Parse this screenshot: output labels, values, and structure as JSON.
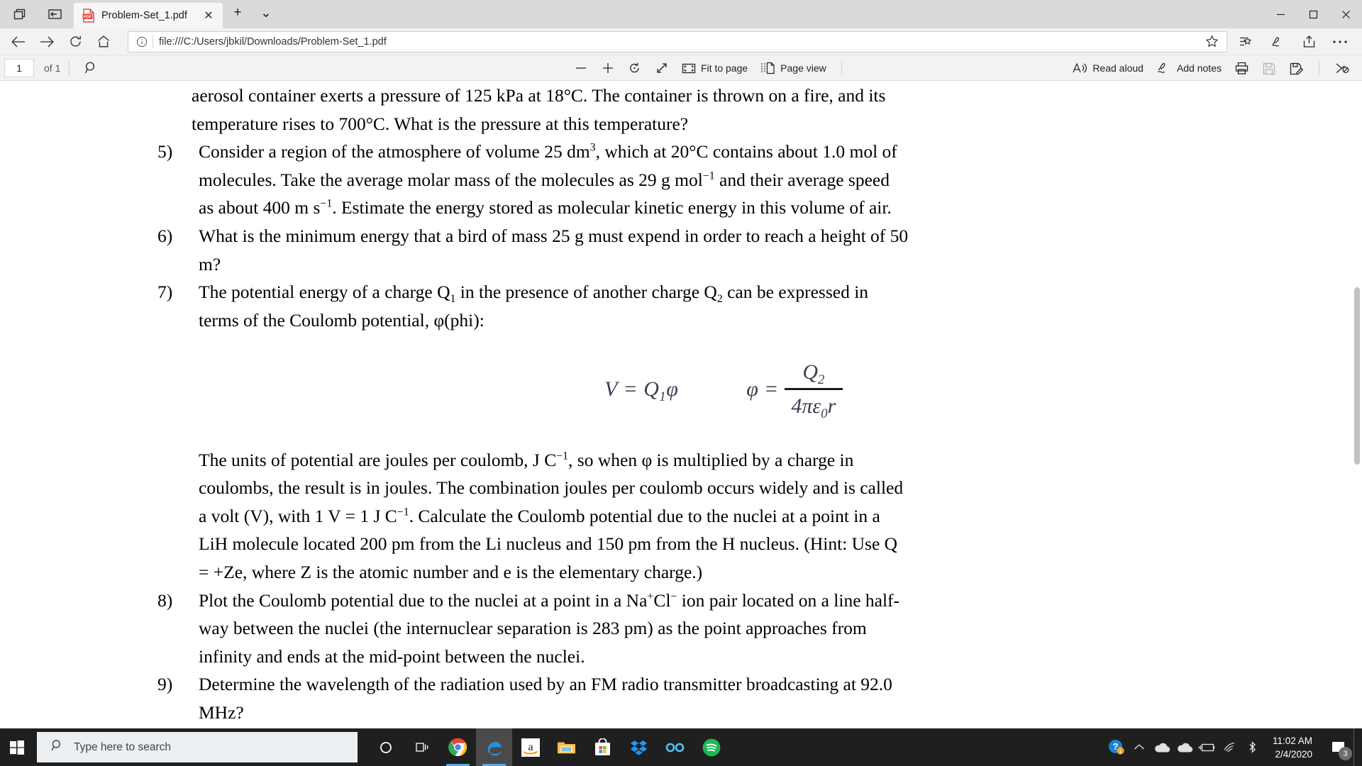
{
  "window": {
    "tab_title": "Problem-Set_1.pdf",
    "close_tab_label": "✕",
    "new_tab_label": "+",
    "tab_menu_label": "⌄",
    "minimize_label": "—",
    "maximize_label": "☐",
    "close_label": "✕"
  },
  "navbar": {
    "back_icon": "back-arrow-icon",
    "forward_icon": "forward-arrow-icon",
    "refresh_icon": "refresh-icon",
    "home_icon": "home-icon",
    "info_icon": "info-icon",
    "url": "file:///C:/Users/jbkil/Downloads/Problem-Set_1.pdf",
    "favorite_icon": "star-icon",
    "favorites_hub_icon": "favorites-list-icon",
    "notes_icon": "web-notes-icon",
    "share_icon": "share-icon",
    "settings_icon": "more-ellipsis-icon"
  },
  "pdf_toolbar": {
    "page_number": "1",
    "page_total": "of 1",
    "search_icon": "search-icon",
    "zoom_out_label": "—",
    "zoom_in_label": "+",
    "rotate_label": "rotate-icon",
    "fit_width_label": "fit-width-icon",
    "fit_to_page": "Fit to page",
    "page_view": "Page view",
    "read_aloud": "Read aloud",
    "add_notes": "Add notes",
    "print_icon": "print-icon",
    "save_icon": "save-icon",
    "save_as_icon": "save-as-icon",
    "pin_icon": "unpin-icon"
  },
  "document": {
    "partial_line_1": "aerosol container exerts a pressure of 125 kPa at 18°C. The container is thrown on a fire, and its",
    "partial_line_2": "temperature rises to 700°C. What is the pressure at this temperature?",
    "questions": [
      {
        "number": "5)",
        "lines": [
          "Consider a region of the atmosphere of volume 25 dm|3|, which at 20°C contains about 1.0 mol of",
          "molecules. Take the average molar mass of the molecules as 29 g mol|−1| and their average speed",
          "as about 400 m s|−1|. Estimate the energy stored as molecular kinetic energy in this volume of air."
        ]
      },
      {
        "number": "6)",
        "lines": [
          "What is the minimum energy that a bird of mass 25 g must expend in order to reach a height of 50",
          "m?"
        ]
      },
      {
        "number": "7)",
        "lines": [
          "The potential energy of a charge Q|~1| in the presence of another charge Q|~2| can be expressed in",
          "terms of the Coulomb potential, φ(phi):"
        ]
      }
    ],
    "equations": {
      "left": {
        "lhs": "V",
        "eq": "=",
        "rhs_base": "Q",
        "rhs_sub": "1",
        "rhs_phi": "ϕ"
      },
      "right": {
        "lhs": "ϕ",
        "eq": "=",
        "numerator_base": "Q",
        "numerator_sub": "2",
        "denominator": "4πε",
        "denominator_sub": "0",
        "denominator_tail": "r"
      }
    },
    "paragraph_7_lines": [
      "The units of potential are joules per coulomb, J C|−1|, so when φ is multiplied by a charge in",
      "coulombs, the result is in joules. The combination joules per coulomb occurs widely and is called",
      "a volt (V), with 1 V = 1 J C|−1|. Calculate the Coulomb potential due to the nuclei at a point in a",
      "LiH molecule located 200 pm from the Li nucleus and 150 pm from the H nucleus. (Hint: Use Q",
      "= +Ze, where Z is the atomic number and e is the elementary charge.)"
    ],
    "questions_tail": [
      {
        "number": "8)",
        "lines": [
          "Plot the Coulomb potential due to the nuclei at a point in a Na|+|Cl|−| ion pair located on a line half-",
          "way between the nuclei (the internuclear separation is 283 pm) as the point approaches from",
          "infinity and ends at the mid-point between the nuclei."
        ]
      },
      {
        "number": "9)",
        "lines": [
          "Determine the wavelength of the radiation used by an FM radio transmitter broadcasting at 92.0",
          "MHz?"
        ]
      }
    ]
  },
  "taskbar": {
    "start_icon": "windows-start-icon",
    "search_placeholder": "Type here to search",
    "search_icon": "search-icon",
    "apps": [
      {
        "name": "cortana-icon"
      },
      {
        "name": "task-view-icon"
      },
      {
        "name": "chrome-icon"
      },
      {
        "name": "edge-icon"
      },
      {
        "name": "amazon-icon"
      },
      {
        "name": "file-explorer-icon"
      },
      {
        "name": "microsoft-store-icon"
      },
      {
        "name": "dropbox-icon"
      },
      {
        "name": "infinity-icon"
      },
      {
        "name": "spotify-icon"
      }
    ],
    "tray": {
      "help_icon": "help-question-icon",
      "show_hidden_icon": "chevron-up-icon",
      "onedrive_icon": "onedrive-cloud-icon",
      "onedrive2_icon": "onedrive-cloud-icon",
      "battery_icon": "battery-charging-icon",
      "wifi_icon": "wifi-icon",
      "bluetooth_icon": "bluetooth-icon",
      "time": "11:02 AM",
      "date": "2/4/2020",
      "notification_icon": "notification-icon",
      "notification_count": "3"
    }
  },
  "colors": {
    "titlebar_bg": "#dadada",
    "tab_bg": "#f6f6f6",
    "toolbar_bg": "#f2f2f2",
    "taskbar_bg": "#1f1f1f",
    "accent_blue": "#5aa8e8",
    "pdf_red": "#e8413a"
  }
}
